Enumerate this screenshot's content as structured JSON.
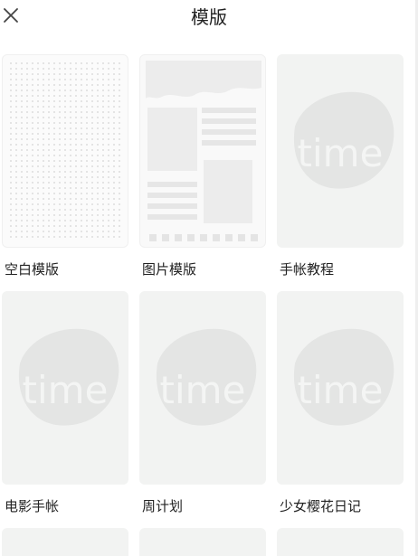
{
  "header": {
    "title": "模版",
    "close_icon": "close-icon"
  },
  "colors": {
    "thumb_bg": "#f2f3f2",
    "placeholder_mark": "#e3e4e3",
    "text": "#222222"
  },
  "templates": [
    {
      "label": "空白模版",
      "thumb": "dot-grid"
    },
    {
      "label": "图片模版",
      "thumb": "photo-layout"
    },
    {
      "label": "手帐教程",
      "thumb": "placeholder",
      "watermark": "time"
    },
    {
      "label": "电影手帐",
      "thumb": "placeholder",
      "watermark": "time"
    },
    {
      "label": "周计划",
      "thumb": "placeholder",
      "watermark": "time"
    },
    {
      "label": "少女樱花日记",
      "thumb": "placeholder",
      "watermark": "time"
    }
  ]
}
